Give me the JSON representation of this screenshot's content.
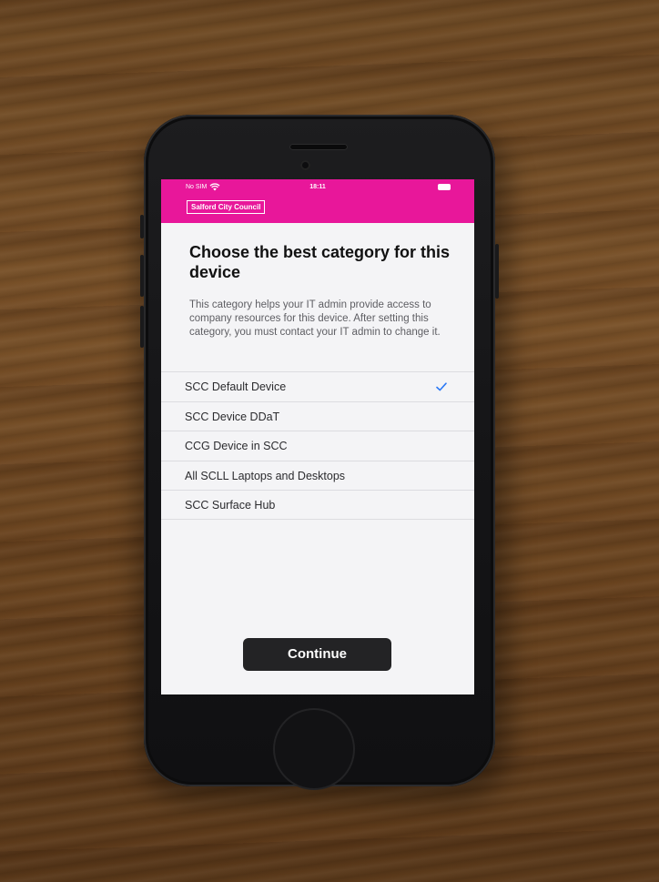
{
  "status_bar": {
    "carrier": "No SIM",
    "time": "18:11"
  },
  "header": {
    "brand": "Salford City Council",
    "color": "#e8179a"
  },
  "page": {
    "title": "Choose the best category for this device",
    "description": "This category helps your IT admin provide access to company resources for this device. After setting this category, you must contact your IT admin to change it."
  },
  "categories": [
    {
      "label": "SCC Default Device",
      "selected": true
    },
    {
      "label": "SCC Device DDaT",
      "selected": false
    },
    {
      "label": "CCG Device in SCC",
      "selected": false
    },
    {
      "label": "All SCLL Laptops and Desktops",
      "selected": false
    },
    {
      "label": "SCC Surface Hub",
      "selected": false
    }
  ],
  "continue_label": "Continue",
  "icons": {
    "wifi": "wifi-icon",
    "battery": "battery-icon",
    "check": "checkmark-icon"
  }
}
